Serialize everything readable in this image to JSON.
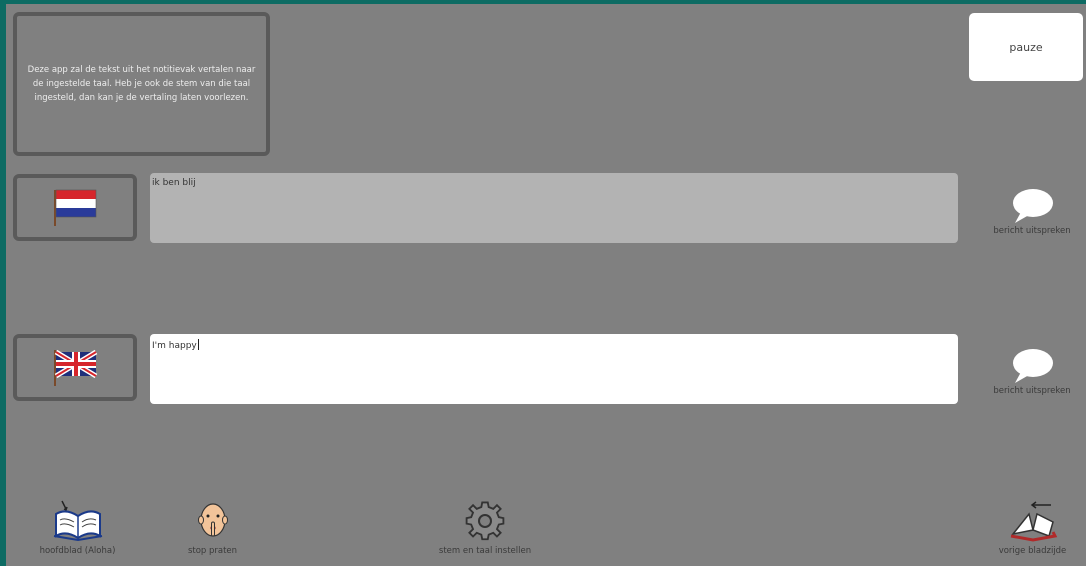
{
  "info": {
    "text": "Deze app zal de tekst uit het notitievak vertalen naar de ingestelde taal. Heb je ook de stem van die taal ingesteld, dan kan je de vertaling laten voorlezen."
  },
  "pause": {
    "label": "pauze"
  },
  "source": {
    "language_icon": "netherlands-flag-icon",
    "text": "ik ben blij"
  },
  "target": {
    "language_icon": "uk-flag-icon",
    "text": "I'm happy"
  },
  "speak": {
    "label_1": "bericht uitspreken",
    "label_2": "bericht uitspreken"
  },
  "bottom": {
    "home_label": "hoofdblad (Aloha)",
    "stop_label": "stop praten",
    "settings_label": "stem en taal instellen",
    "back_label": "vorige bladzijde"
  },
  "colors": {
    "background_frame": "#808080",
    "border_teal": "#0d6b63",
    "source_field": "#b3b3b3",
    "target_field": "#ffffff"
  }
}
